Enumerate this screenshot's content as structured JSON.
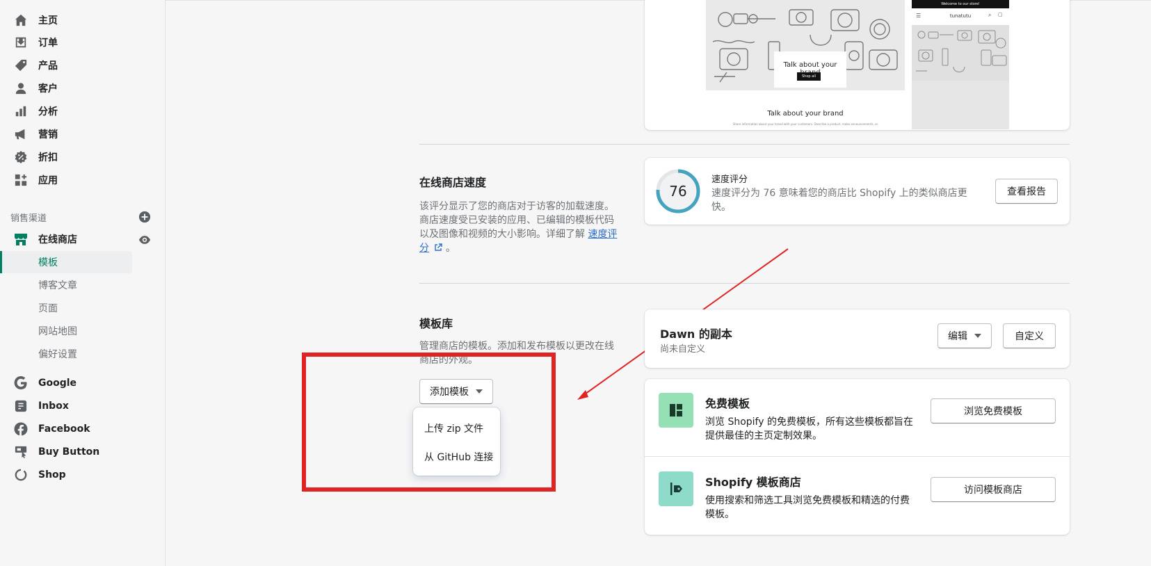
{
  "sidebar": {
    "items": [
      {
        "label": "主页",
        "icon": "home-icon"
      },
      {
        "label": "订单",
        "icon": "orders-icon"
      },
      {
        "label": "产品",
        "icon": "tag-icon"
      },
      {
        "label": "客户",
        "icon": "customer-icon"
      },
      {
        "label": "分析",
        "icon": "analytics-icon"
      },
      {
        "label": "营销",
        "icon": "megaphone-icon"
      },
      {
        "label": "折扣",
        "icon": "discount-icon"
      },
      {
        "label": "应用",
        "icon": "apps-icon"
      }
    ],
    "channels_label": "销售渠道",
    "online_store": {
      "label": "在线商店",
      "icon": "store-icon"
    },
    "sub_items": [
      {
        "label": "模板",
        "active": true
      },
      {
        "label": "博客文章"
      },
      {
        "label": "页面"
      },
      {
        "label": "网站地图"
      },
      {
        "label": "偏好设置"
      }
    ],
    "channels": [
      {
        "label": "Google",
        "icon": "google-icon"
      },
      {
        "label": "Inbox",
        "icon": "inbox-icon"
      },
      {
        "label": "Facebook",
        "icon": "facebook-icon"
      },
      {
        "label": "Buy Button",
        "icon": "buy-button-icon"
      },
      {
        "label": "Shop",
        "icon": "shop-icon"
      }
    ]
  },
  "preview": {
    "desktop_banner_text": "Talk about your brand",
    "desktop_banner_button": "Shop all",
    "desktop_footer_title": "Talk about your brand",
    "desktop_footer_text": "Share information about your brand with your customers. Describe a product, make announcements, or",
    "mobile_announcement": "Welcome to our store!",
    "mobile_store_name": "tunatutu"
  },
  "speed": {
    "title": "在线商店速度",
    "description": "该评分显示了您的商店对于访客的加载速度。商店速度受已安装的应用、已编辑的模板代码以及图像和视频的大小影响。详细了解",
    "link_text": "速度评分",
    "trailing": "。",
    "score": "76",
    "score_fraction": 0.76,
    "score_label": "速度评分",
    "score_desc": "速度评分为 76 意味着您的商店比 Shopify 上的类似商店更快。",
    "report_button": "查看报告"
  },
  "library": {
    "title": "模板库",
    "description": "管理商店的模板。添加和发布模板以更改在线商店的外观。",
    "add_button": "添加模板",
    "dropdown": [
      "上传 zip 文件",
      "从 GitHub 连接"
    ],
    "theme_name": "Dawn 的副本",
    "theme_status": "尚未自定义",
    "edit_button": "编辑",
    "customize_button": "自定义"
  },
  "free_themes": {
    "title": "免费模板",
    "description": "浏览 Shopify 的免费模板，所有这些模板都旨在提供最佳的主页定制效果。",
    "button": "浏览免费模板",
    "icon_color": "#95e1b5"
  },
  "theme_store": {
    "title": "Shopify 模板商店",
    "description": "使用搜索和筛选工具浏览免费模板和精选的付费模板。",
    "button": "访问模板商店",
    "icon_color": "#8edbc9"
  },
  "colors": {
    "accent": "#008060",
    "link": "#2c6ecb",
    "annotation": "#e02424"
  }
}
